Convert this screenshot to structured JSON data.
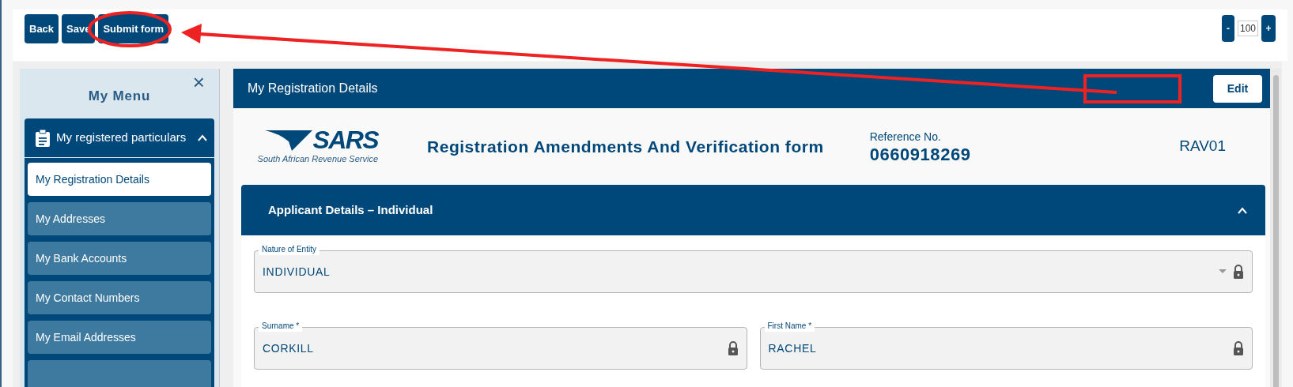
{
  "toolbar": {
    "buttons": [
      {
        "label": "Back"
      },
      {
        "label": "Save"
      },
      {
        "label": "Submit form"
      }
    ],
    "zoom": {
      "minus": "-",
      "value": "100",
      "plus": "+"
    }
  },
  "sidebar": {
    "title": "My Menu",
    "close": "×",
    "group": {
      "label": "My registered particulars",
      "expanded": true,
      "items": [
        {
          "label": "My Registration Details",
          "selected": true
        },
        {
          "label": "My Addresses",
          "selected": false
        },
        {
          "label": "My Bank Accounts",
          "selected": false
        },
        {
          "label": "My Contact Numbers",
          "selected": false
        },
        {
          "label": "My Email Addresses",
          "selected": false
        }
      ]
    }
  },
  "panel": {
    "title": "My Registration Details",
    "edit_button": "Edit",
    "form_header": {
      "logo_text": "SARS",
      "logo_subtitle": "South African Revenue Service",
      "title": "Registration Amendments And Verification form",
      "reference_label": "Reference No.",
      "reference_number": "0660918269",
      "form_code": "RAV01"
    },
    "section": {
      "title": "Applicant Details – Individual",
      "expanded": true,
      "rows": [
        [
          {
            "label": "Nature of Entity",
            "value": "INDIVIDUAL",
            "kind": "dropdown",
            "locked": true
          }
        ],
        [
          {
            "label": "Surname *",
            "value": "CORKILL",
            "kind": "text",
            "locked": true
          },
          {
            "label": "First Name *",
            "value": "RACHEL",
            "kind": "text",
            "locked": true
          }
        ]
      ]
    }
  }
}
